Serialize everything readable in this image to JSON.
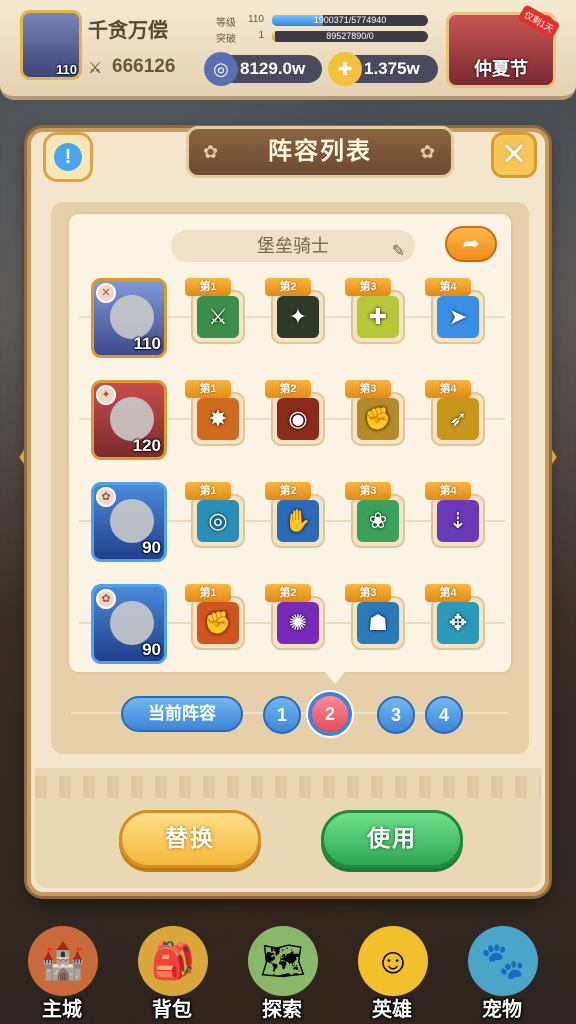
{
  "player": {
    "name": "千贪万偿",
    "level": "110",
    "power": "666126",
    "grade_label": "等级",
    "grade_value": "110",
    "grade_progress": "1900371/5774940",
    "grade_fraction": 0.33,
    "breakthrough_label": "突破",
    "breakthrough_value": "1",
    "breakthrough_progress": "89527890/0",
    "breakthrough_fraction": 0.02
  },
  "currencies": {
    "coins": "8129.0w",
    "gold": "1.375w"
  },
  "event": {
    "label": "仲夏节",
    "tag": "仅剩1天"
  },
  "dialog": {
    "title": "阵容列表",
    "team_name": "堡垒骑士",
    "heroes": [
      {
        "level": "110",
        "skills": [
          "第1",
          "第2",
          "第3",
          "第4"
        ],
        "skill_icons": [
          "⚔",
          "✦",
          "✚",
          "➤"
        ],
        "skill_colors": [
          "#3b8f4a",
          "#2d3a2a",
          "#b4c83a",
          "#3a8ee6"
        ]
      },
      {
        "level": "120",
        "skills": [
          "第1",
          "第2",
          "第3",
          "第4"
        ],
        "skill_icons": [
          "✸",
          "◉",
          "✊",
          "➶"
        ],
        "skill_colors": [
          "#d06a1e",
          "#8a2a1a",
          "#b48a2a",
          "#c8961a"
        ]
      },
      {
        "level": "90",
        "skills": [
          "第1",
          "第2",
          "第3",
          "第4"
        ],
        "skill_icons": [
          "◎",
          "✋",
          "❀",
          "⇣"
        ],
        "skill_colors": [
          "#2a8fb8",
          "#2a6ab8",
          "#3aa05a",
          "#6a3ab8"
        ]
      },
      {
        "level": "90",
        "skills": [
          "第1",
          "第2",
          "第3",
          "第4"
        ],
        "skill_icons": [
          "✊",
          "✺",
          "☗",
          "✥"
        ],
        "skill_colors": [
          "#d0541e",
          "#7a2ab8",
          "#2a7ab8",
          "#2a9ab8"
        ]
      }
    ],
    "current_team_label": "当前阵容",
    "team_slots": [
      "1",
      "2",
      "3",
      "4"
    ],
    "active_slot": 2,
    "replace_label": "替换",
    "use_label": "使用"
  },
  "nav": {
    "items": [
      {
        "label": "主城",
        "icon": "castle-icon"
      },
      {
        "label": "背包",
        "icon": "backpack-icon"
      },
      {
        "label": "探索",
        "icon": "map-icon"
      },
      {
        "label": "英雄",
        "icon": "hero-icon"
      },
      {
        "label": "宠物",
        "icon": "pet-icon"
      }
    ]
  }
}
